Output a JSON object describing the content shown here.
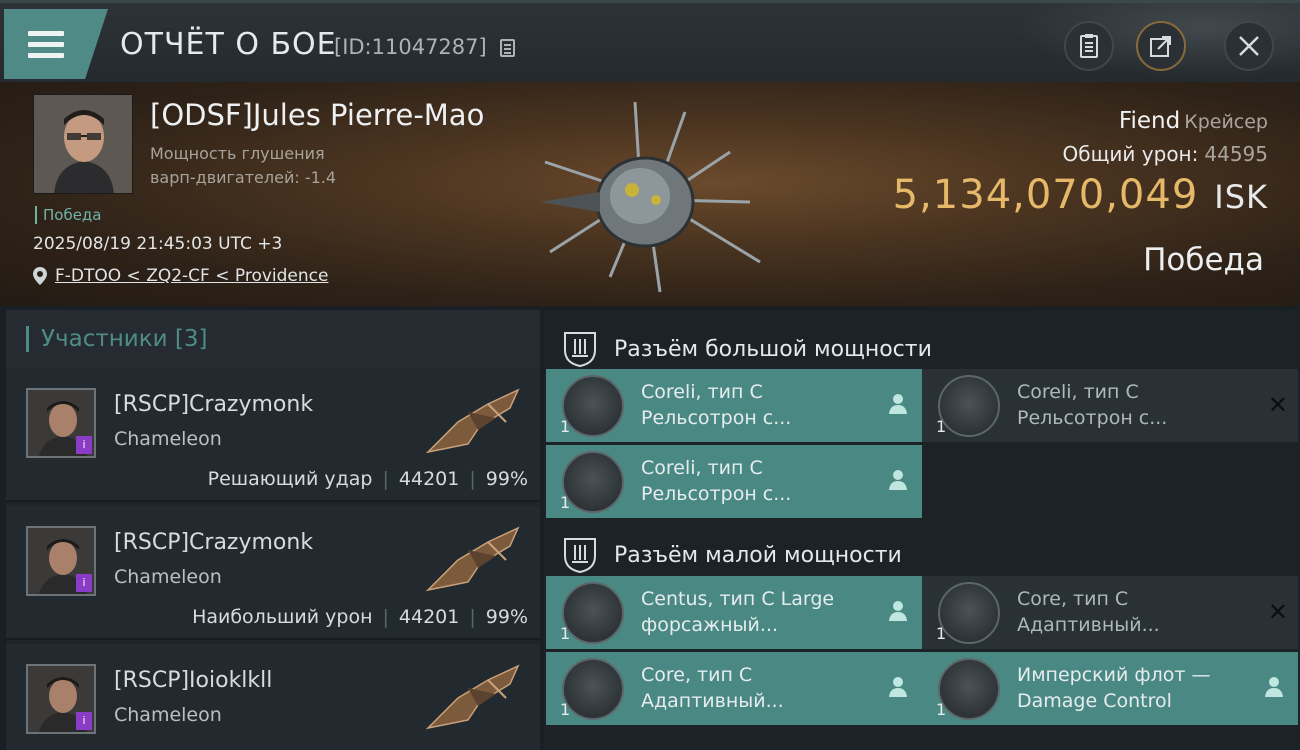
{
  "header": {
    "title": "ОТЧЁТ О БОЕ",
    "report_id": "[ID:11047287]"
  },
  "victim": {
    "name": "[ODSF]Jules Pierre-Mao",
    "stat_line1": "Мощность глушения",
    "stat_line2": "варп-двигателей: -1.4",
    "tag": "Победа",
    "datetime": "2025/08/19 21:45:03 UTC +3",
    "location": "F-DTOO < ZQ2-CF < Providence",
    "ship": "Fiend",
    "ship_class": "Крейсер",
    "damage_label": "Общий урон:",
    "damage_value": "44595",
    "isk_value": "5,134,070,049",
    "isk_unit": "ISK",
    "result": "Победа"
  },
  "participants": {
    "title": "Участники [3]",
    "items": [
      {
        "name": "[RSCP]Crazymonk",
        "ship": "Chameleon",
        "role": "Решающий удар",
        "damage": "44201",
        "percent": "99%"
      },
      {
        "name": "[RSCP]Crazymonk",
        "ship": "Chameleon",
        "role": "Наибольший урон",
        "damage": "44201",
        "percent": "99%"
      },
      {
        "name": "[RSCP]Ioioklkll",
        "ship": "Chameleon",
        "role": "",
        "damage": "",
        "percent": ""
      }
    ]
  },
  "fitting": {
    "high_slot_label": "Разъём большой мощности",
    "low_slot_label": "Разъём малой мощности",
    "high": [
      {
        "qty": "1",
        "line1": "Coreli, тип C",
        "line2": "Рельсотрон с...",
        "state": "active"
      },
      {
        "qty": "1",
        "line1": "Coreli, тип C",
        "line2": "Рельсотрон с...",
        "state": "destroyed"
      },
      {
        "qty": "1",
        "line1": "Coreli, тип C",
        "line2": "Рельсотрон с...",
        "state": "active"
      }
    ],
    "low": [
      {
        "qty": "1",
        "line1": "Centus, тип C Large",
        "line2": "форсажный...",
        "state": "active"
      },
      {
        "qty": "1",
        "line1": "Core, тип C",
        "line2": "Адаптивный...",
        "state": "destroyed"
      },
      {
        "qty": "1",
        "line1": "Core, тип C",
        "line2": "Адаптивный...",
        "state": "active"
      },
      {
        "qty": "1",
        "line1": "Имперский флот —",
        "line2": "Damage Control",
        "state": "active"
      }
    ]
  },
  "icons": {
    "menu": "hamburger-icon",
    "copy": "copy-icon",
    "clipboard": "clipboard-icon",
    "share": "share-icon",
    "close": "close-icon",
    "pin": "map-pin-icon",
    "shield": "shield-slot-icon",
    "user": "user-icon",
    "destroyed": "x-icon"
  },
  "colors": {
    "accent": "#4a8983",
    "isk": "#e6b86a",
    "victory": "#6fb3a7",
    "badge": "#8a3cc7"
  }
}
